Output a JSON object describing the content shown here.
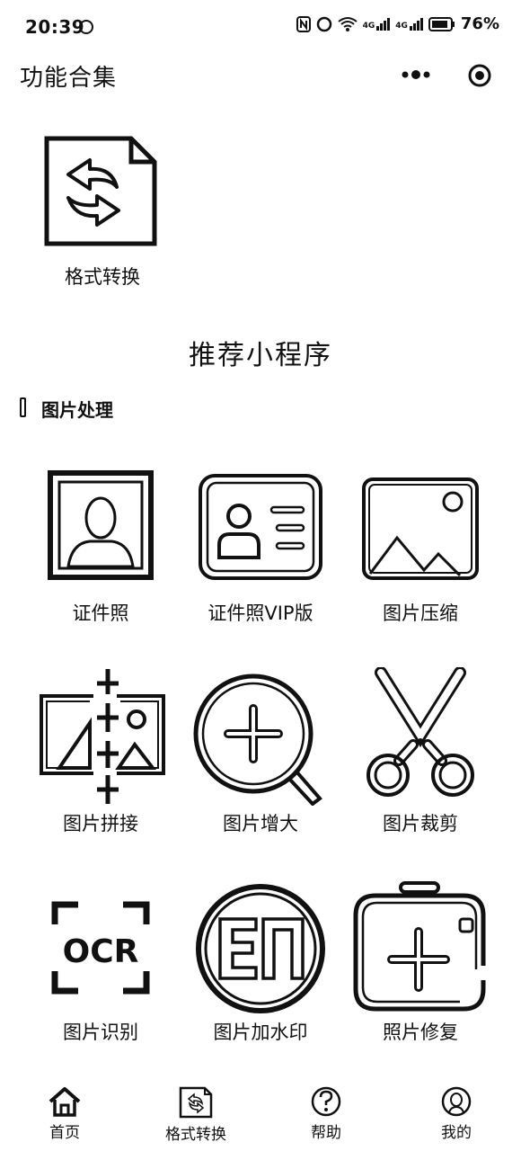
{
  "status_bar": {
    "time": "20:39",
    "signal1": "4G",
    "signal2": "4G",
    "battery": "76%"
  },
  "header": {
    "title": "功能合集"
  },
  "feature": {
    "label": "格式转换"
  },
  "section": {
    "title": "推荐小程序"
  },
  "group": {
    "title": "图片处理"
  },
  "tools": [
    {
      "label": "证件照",
      "icon": "portrait-icon"
    },
    {
      "label": "证件照VIP版",
      "icon": "id-card-icon"
    },
    {
      "label": "图片压缩",
      "icon": "image-icon"
    },
    {
      "label": "图片拼接",
      "icon": "image-stitch-icon"
    },
    {
      "label": "图片增大",
      "icon": "magnify-plus-icon"
    },
    {
      "label": "图片裁剪",
      "icon": "scissors-icon"
    },
    {
      "label": "图片识别",
      "icon": "ocr-icon"
    },
    {
      "label": "图片加水印",
      "icon": "watermark-icon"
    },
    {
      "label": "照片修复",
      "icon": "photo-repair-icon"
    }
  ],
  "ocr_text": "OCR",
  "watermark_text": "EN",
  "bottom_nav": [
    {
      "label": "首页",
      "icon": "home-icon"
    },
    {
      "label": "格式转换",
      "icon": "convert-icon"
    },
    {
      "label": "帮助",
      "icon": "help-icon"
    },
    {
      "label": "我的",
      "icon": "profile-icon"
    }
  ]
}
